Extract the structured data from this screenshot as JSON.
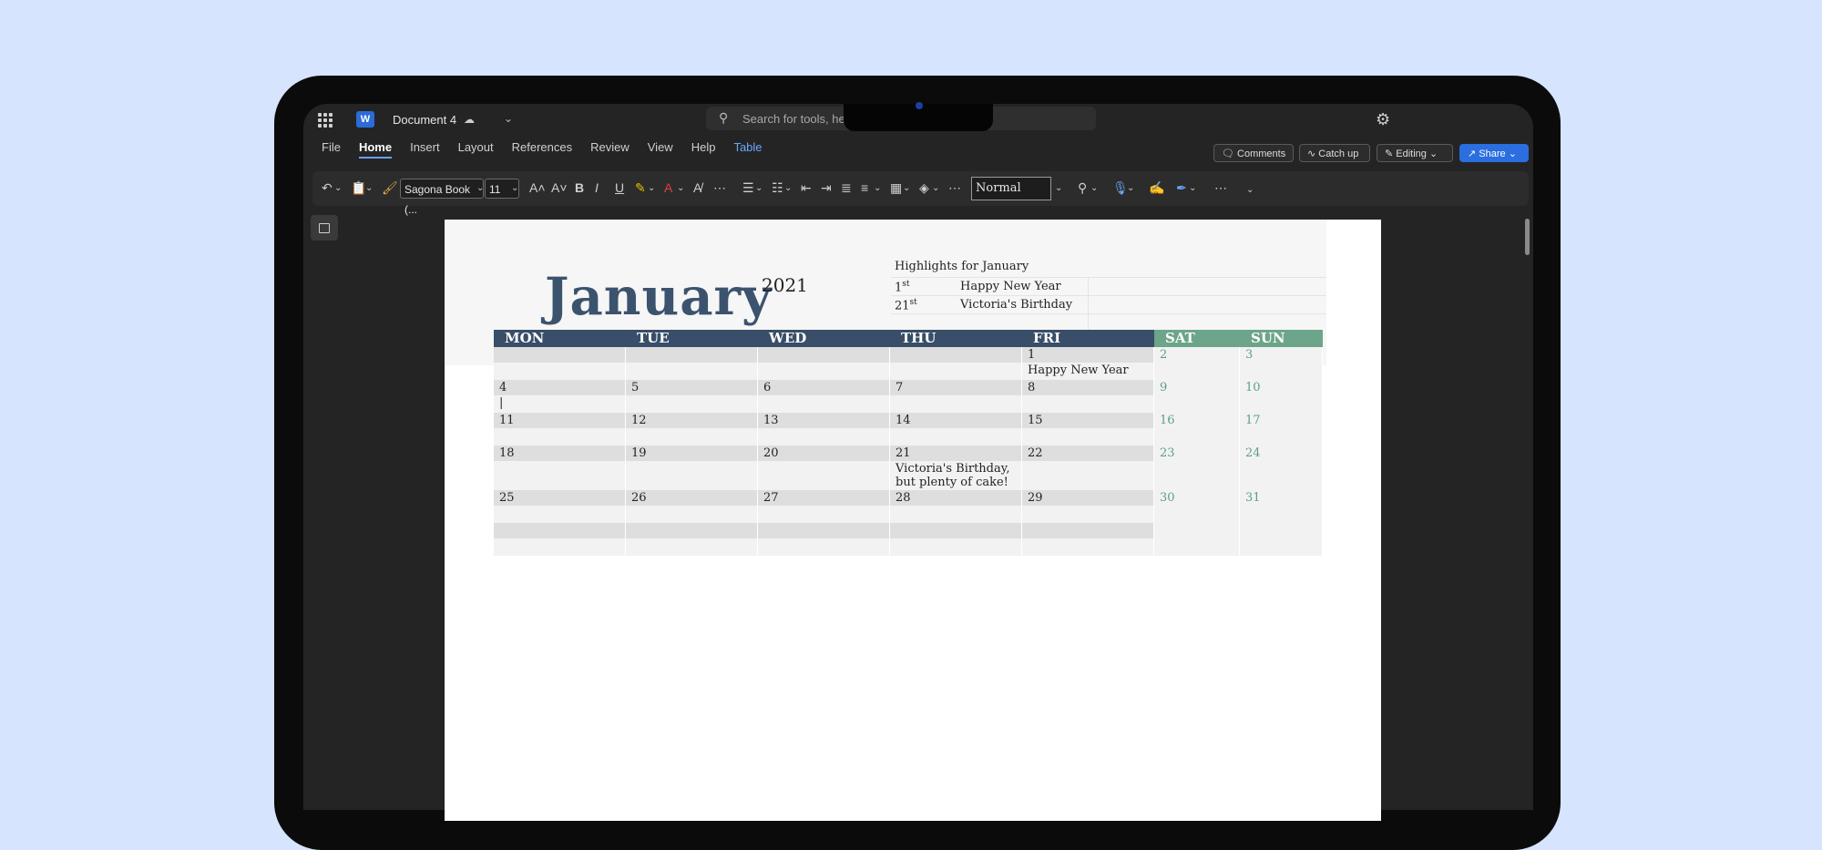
{
  "app": {
    "document_title": "Document 4",
    "search_placeholder": "Search for tools, he"
  },
  "menu": {
    "items": [
      "File",
      "Home",
      "Insert",
      "Layout",
      "References",
      "Review",
      "View",
      "Help",
      "Table"
    ],
    "active": "Home"
  },
  "actions": {
    "comments": "Comments",
    "catch_up": "Catch up",
    "editing": "Editing",
    "share": "Share"
  },
  "ribbon": {
    "font_name": "Sagona Book (...",
    "font_size": "11",
    "style": "Normal"
  },
  "colors": {
    "accent": "#2a6ee0",
    "header_navy": "#384e69",
    "weekend_green": "#6ca58a",
    "month_title": "#3c536e"
  },
  "calendar": {
    "month": "January",
    "year": "2021",
    "highlights_title": "Highlights for January",
    "highlights": [
      {
        "day": "1",
        "suffix": "st",
        "event": "Happy New Year"
      },
      {
        "day": "21",
        "suffix": "st",
        "event": "Victoria's Birthday"
      }
    ],
    "day_headers": [
      "MON",
      "TUE",
      "WED",
      "THU",
      "FRI",
      "SAT",
      "SUN"
    ],
    "weeks": [
      {
        "days": [
          "",
          "",
          "",
          "",
          "1",
          "2",
          "3"
        ],
        "events": [
          "",
          "",
          "",
          "",
          "Happy New Year",
          "",
          ""
        ]
      },
      {
        "days": [
          "4",
          "5",
          "6",
          "7",
          "8",
          "9",
          "10"
        ],
        "events": [
          "|",
          "",
          "",
          "",
          "",
          "",
          ""
        ]
      },
      {
        "days": [
          "11",
          "12",
          "13",
          "14",
          "15",
          "16",
          "17"
        ],
        "events": [
          "",
          "",
          "",
          "",
          "",
          "",
          ""
        ]
      },
      {
        "days": [
          "18",
          "19",
          "20",
          "21",
          "22",
          "23",
          "24"
        ],
        "events": [
          "",
          "",
          "",
          "Victoria's Birthday, but plenty of cake!",
          "",
          "",
          ""
        ]
      },
      {
        "days": [
          "25",
          "26",
          "27",
          "28",
          "29",
          "30",
          "31"
        ],
        "events": [
          "",
          "",
          "",
          "",
          "",
          "",
          ""
        ]
      },
      {
        "days": [
          "",
          "",
          "",
          "",
          "",
          "",
          ""
        ],
        "events": [
          "",
          "",
          "",
          "",
          "",
          "",
          ""
        ]
      }
    ]
  }
}
